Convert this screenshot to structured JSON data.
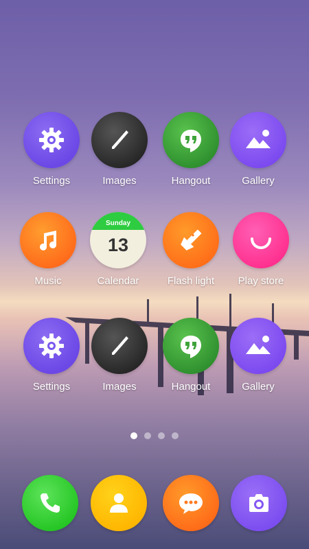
{
  "home_grid": {
    "row1": [
      {
        "label": "Settings",
        "icon": "gear-icon",
        "color": "#7a58ee"
      },
      {
        "label": "Images",
        "icon": "paintbrush-icon",
        "color": "#2d2d2d"
      },
      {
        "label": "Hangout",
        "icon": "quote-bubble-icon",
        "color": "#3ea33a"
      },
      {
        "label": "Gallery",
        "icon": "mountain-icon",
        "color": "#8457f2"
      }
    ],
    "row2": [
      {
        "label": "Music",
        "icon": "music-note-icon",
        "color": "#ff7a1f"
      },
      {
        "label": "Calendar",
        "icon": "calendar-icon",
        "weekday": "Sunday",
        "day": "13",
        "color": "#2ecc40"
      },
      {
        "label": "Flash light",
        "icon": "flashlight-icon",
        "color": "#ff7a1f"
      },
      {
        "label": "Play store",
        "icon": "ring-icon",
        "color": "#ff3e9c"
      }
    ],
    "row3": [
      {
        "label": "Settings",
        "icon": "gear-icon",
        "color": "#7a58ee"
      },
      {
        "label": "Images",
        "icon": "paintbrush-icon",
        "color": "#2d2d2d"
      },
      {
        "label": "Hangout",
        "icon": "quote-bubble-icon",
        "color": "#3ea33a"
      },
      {
        "label": "Gallery",
        "icon": "mountain-icon",
        "color": "#8457f2"
      }
    ]
  },
  "pager": {
    "pages": 4,
    "active": 1
  },
  "dock": [
    {
      "icon": "phone-icon",
      "color": "#2ed12c"
    },
    {
      "icon": "contact-icon",
      "color": "#ffc107"
    },
    {
      "icon": "chat-bubble-icon",
      "color": "#ff7a1f"
    },
    {
      "icon": "camera-icon",
      "color": "#8457f2"
    }
  ]
}
